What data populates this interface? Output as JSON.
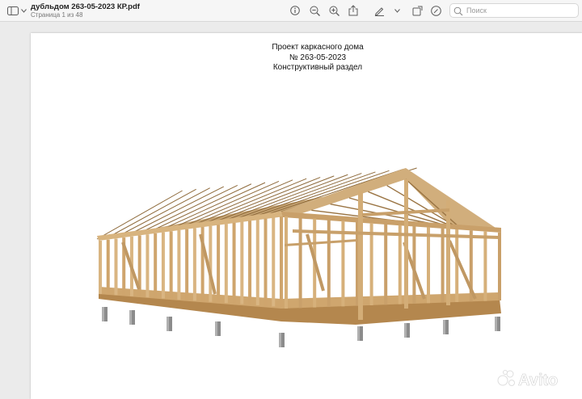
{
  "window": {
    "doc_title": "дубльдом 263-05-2023 КР.pdf",
    "page_status": "Страница 1 из 48"
  },
  "toolbar": {
    "search_placeholder": "Поиск",
    "icons": [
      "sidebar-toggle-icon",
      "chevron-down-icon",
      "info-icon",
      "zoom-out-icon",
      "zoom-in-icon",
      "share-icon",
      "markup-pen-icon",
      "chevron-down-icon",
      "window-icon",
      "markup-circle-icon",
      "search-icon"
    ]
  },
  "document": {
    "heading_line1": "Проект каркасного дома",
    "heading_line2": "№ 263-05-2023",
    "heading_line3": "Конструктивный раздел",
    "illustration": "timber-frame-house-render"
  },
  "watermark": {
    "brand": "Avito",
    "colors": [
      "#ffffff"
    ]
  }
}
